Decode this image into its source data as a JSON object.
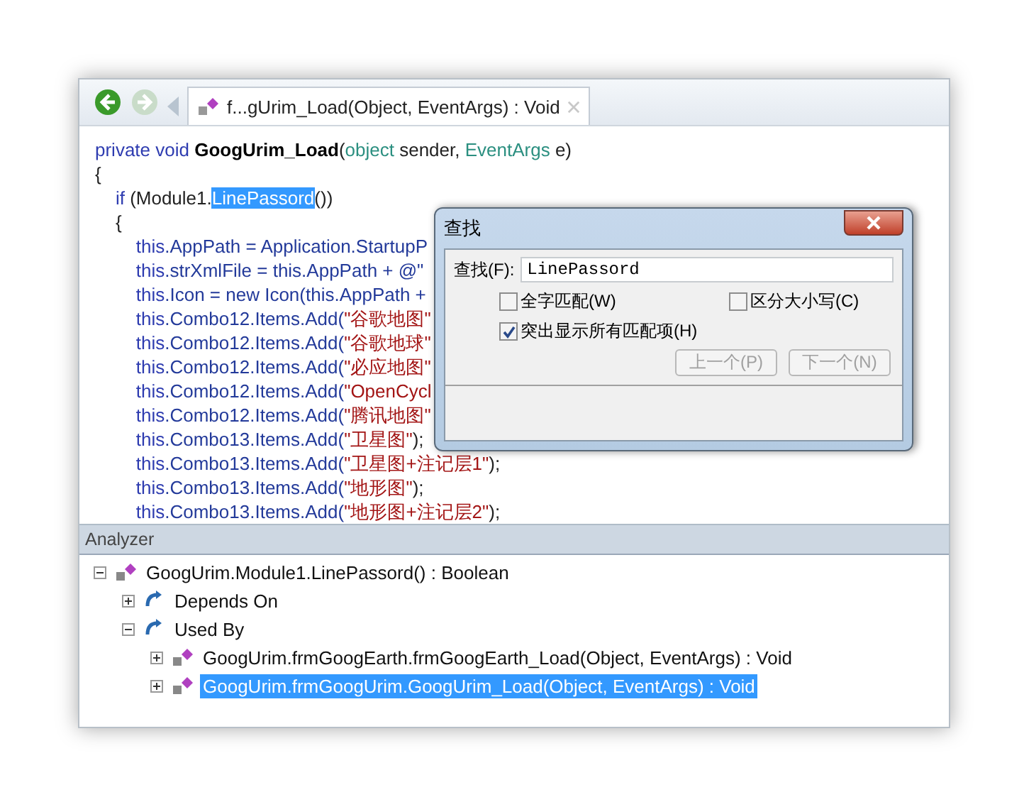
{
  "toolbar": {
    "back": {
      "disabled": false
    },
    "forward": {
      "disabled": true
    }
  },
  "tab": {
    "label": "f...gUrim_Load(Object, EventArgs) : Void",
    "selected": true
  },
  "code_lines": [
    [
      {
        "t": "private void ",
        "kind": "kw"
      },
      {
        "t": "GoogUrim_Load",
        "kind": "bold"
      },
      {
        "t": "(",
        "kind": "plain"
      },
      {
        "t": "object",
        "kind": "type"
      },
      {
        "t": " sender, ",
        "kind": "plain"
      },
      {
        "t": "EventArgs",
        "kind": "type"
      },
      {
        "t": " e)",
        "kind": "plain"
      }
    ],
    [
      {
        "t": "{",
        "kind": "plain"
      }
    ],
    [
      {
        "t": "    if",
        "kind": "kw"
      },
      {
        "t": " (Module1.",
        "kind": "plain"
      },
      {
        "t": "LinePassord",
        "kind": "match"
      },
      {
        "t": "())",
        "kind": "plain"
      }
    ],
    [
      {
        "t": "    {",
        "kind": "plain"
      }
    ],
    [
      {
        "t": "        this",
        "kind": "kw"
      },
      {
        "t": ".AppPath = Application.StartupP",
        "kind": "id"
      }
    ],
    [
      {
        "t": "        this",
        "kind": "kw"
      },
      {
        "t": ".strXmlFile = this.AppPath + @\"",
        "kind": "id"
      }
    ],
    [
      {
        "t": "        this",
        "kind": "kw"
      },
      {
        "t": ".Icon = new Icon(this.AppPath +",
        "kind": "id"
      }
    ],
    [
      {
        "t": "        this",
        "kind": "kw"
      },
      {
        "t": ".Combo12.Items.Add(",
        "kind": "id"
      },
      {
        "t": "\"谷歌地图\"",
        "kind": "str"
      }
    ],
    [
      {
        "t": "        this",
        "kind": "kw"
      },
      {
        "t": ".Combo12.Items.Add(",
        "kind": "id"
      },
      {
        "t": "\"谷歌地球\"",
        "kind": "str"
      }
    ],
    [
      {
        "t": "        this",
        "kind": "kw"
      },
      {
        "t": ".Combo12.Items.Add(",
        "kind": "id"
      },
      {
        "t": "\"必应地图\"",
        "kind": "str"
      }
    ],
    [
      {
        "t": "        this",
        "kind": "kw"
      },
      {
        "t": ".Combo12.Items.Add(",
        "kind": "id"
      },
      {
        "t": "\"OpenCycl",
        "kind": "str"
      }
    ],
    [
      {
        "t": "        this",
        "kind": "kw"
      },
      {
        "t": ".Combo12.Items.Add(",
        "kind": "id"
      },
      {
        "t": "\"腾讯地图\"",
        "kind": "str"
      }
    ],
    [
      {
        "t": "        this",
        "kind": "kw"
      },
      {
        "t": ".Combo13.Items.Add(",
        "kind": "id"
      },
      {
        "t": "\"卫星图\"",
        "kind": "str"
      },
      {
        "t": ");",
        "kind": "plain"
      }
    ],
    [
      {
        "t": "        this",
        "kind": "kw"
      },
      {
        "t": ".Combo13.Items.Add(",
        "kind": "id"
      },
      {
        "t": "\"卫星图+注记层1\"",
        "kind": "str"
      },
      {
        "t": ");",
        "kind": "plain"
      }
    ],
    [
      {
        "t": "        this",
        "kind": "kw"
      },
      {
        "t": ".Combo13.Items.Add(",
        "kind": "id"
      },
      {
        "t": "\"地形图\"",
        "kind": "str"
      },
      {
        "t": ");",
        "kind": "plain"
      }
    ],
    [
      {
        "t": "        this",
        "kind": "kw"
      },
      {
        "t": ".Combo13.Items.Add(",
        "kind": "id"
      },
      {
        "t": "\"地形图+注记层2\"",
        "kind": "str"
      },
      {
        "t": ");",
        "kind": "plain"
      }
    ]
  ],
  "find_dialog": {
    "title": "查找",
    "label": "查找(F):",
    "value": "LinePassord",
    "options": [
      {
        "label": "全字匹配(W)",
        "checked": false
      },
      {
        "label": "区分大小写(C)",
        "checked": false
      },
      {
        "label": "突出显示所有匹配项(H)",
        "checked": true
      }
    ],
    "buttons": [
      {
        "label": "上一个(P)",
        "disabled": true
      },
      {
        "label": "下一个(N)",
        "disabled": true
      }
    ]
  },
  "analyzer": {
    "title": "Analyzer",
    "tree": [
      {
        "label": "GoogUrim.Module1.LinePassord() : Boolean",
        "kind": "method",
        "expanded": true,
        "selected": false,
        "children": [
          {
            "label": "Depends On",
            "kind": "group",
            "expanded": false,
            "selected": false
          },
          {
            "label": "Used By",
            "kind": "group",
            "expanded": true,
            "selected": false,
            "children": [
              {
                "label": "GoogUrim.frmGoogEarth.frmGoogEarth_Load(Object, EventArgs) : Void",
                "kind": "method",
                "expanded": false,
                "selected": false
              },
              {
                "label": "GoogUrim.frmGoogUrim.GoogUrim_Load(Object, EventArgs) : Void",
                "kind": "method",
                "expanded": false,
                "selected": true
              }
            ]
          }
        ]
      }
    ]
  }
}
